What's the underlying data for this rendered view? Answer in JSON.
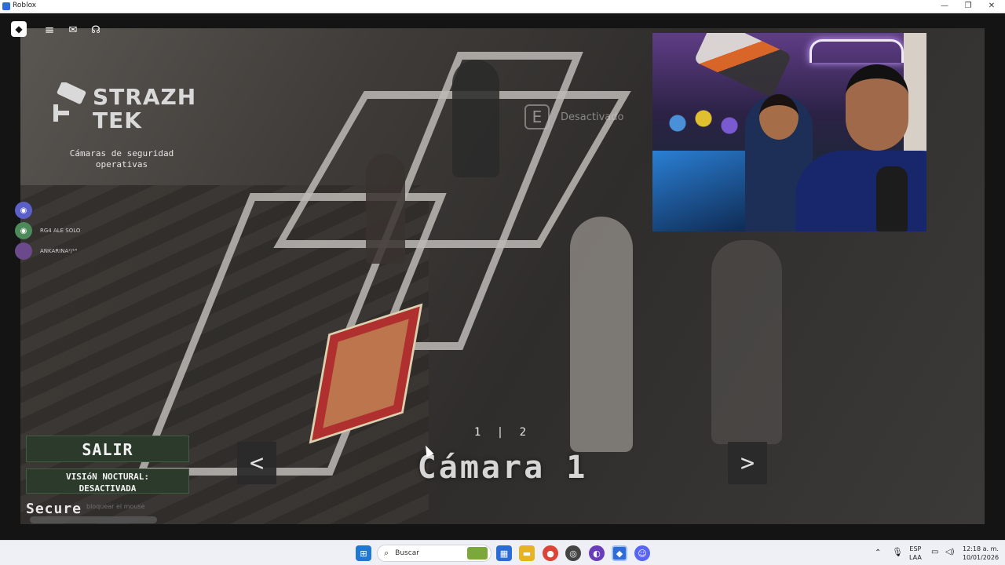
{
  "window": {
    "title": "Roblox",
    "controls": {
      "minimize": "—",
      "maximize": "❐",
      "close": "✕"
    }
  },
  "game": {
    "logo": {
      "line1": "STRAZH",
      "line2": "TEK",
      "subtitle": "Cámaras de seguridad operativas"
    },
    "interact_prompt": {
      "key": "E",
      "label": "Desactivado"
    },
    "friends": [
      {
        "name": "",
        "color": "#5b60c8"
      },
      {
        "name": "RG4 ALE SOLO",
        "color": "#4c8a5a"
      },
      {
        "name": "ANKARINA²/¹⁴",
        "color": "#6a4a8a"
      }
    ],
    "buttons": {
      "exit": "SALIR",
      "night_vision_line1": "VISIóN NOCTURAL:",
      "night_vision_line2": "DESACTIVADA"
    },
    "secure_label": "Secure",
    "hint": "bloquear el mouse",
    "camera": {
      "index_text": "1 | 2",
      "name": "Cámara 1",
      "prev": "<",
      "next": ">"
    }
  },
  "taskbar": {
    "search_placeholder": "Buscar",
    "language_top": "ESP",
    "language_bottom": "LAA",
    "time": "12:18 a. m.",
    "date": "10/01/2026",
    "apps": [
      {
        "name": "start-icon",
        "color": "#1f78d1"
      },
      {
        "name": "widgets-icon",
        "color": "#7aa83a"
      },
      {
        "name": "store-icon",
        "color": "#2b6cd6"
      },
      {
        "name": "file-explorer-icon",
        "color": "#e6b422"
      },
      {
        "name": "chrome-icon",
        "color": "#db4437"
      },
      {
        "name": "obs-icon",
        "color": "#444"
      },
      {
        "name": "streamlabs-icon",
        "color": "#6a3db8"
      },
      {
        "name": "roblox-icon",
        "color": "#2f6bd8"
      },
      {
        "name": "discord-icon",
        "color": "#5865f2"
      }
    ]
  }
}
